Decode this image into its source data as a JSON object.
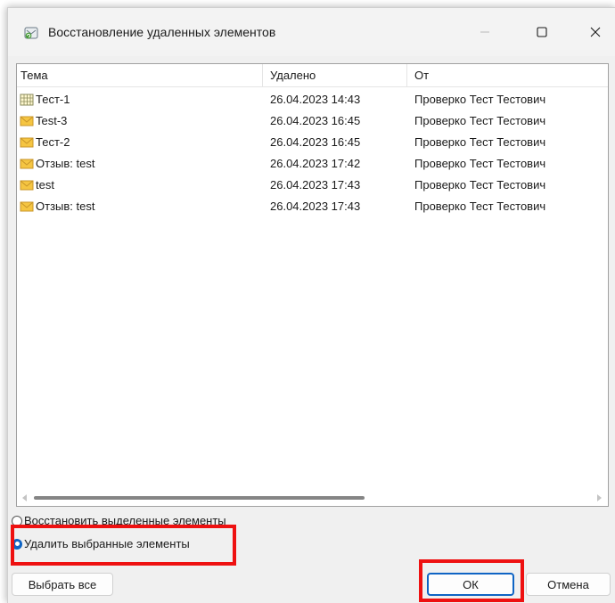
{
  "window": {
    "title": "Восстановление удаленных элементов",
    "icon": "restore-mailbox-icon",
    "controls": [
      "minimize-icon",
      "maximize-icon",
      "close-icon"
    ]
  },
  "list": {
    "columns": [
      "Тема",
      "Удалено",
      "От"
    ],
    "rows": [
      {
        "icon": "calendar-item-icon",
        "subject": "Тест-1",
        "deleted": "26.04.2023 14:43",
        "from": "Проверко Тест Тестович"
      },
      {
        "icon": "envelope-icon",
        "subject": "Test-3",
        "deleted": "26.04.2023 16:45",
        "from": "Проверко Тест Тестович"
      },
      {
        "icon": "envelope-icon",
        "subject": "Тест-2",
        "deleted": "26.04.2023 16:45",
        "from": "Проверко Тест Тестович"
      },
      {
        "icon": "envelope-icon",
        "subject": "Отзыв: test",
        "deleted": "26.04.2023 17:42",
        "from": "Проверко Тест Тестович"
      },
      {
        "icon": "envelope-icon",
        "subject": "test",
        "deleted": "26.04.2023 17:43",
        "from": "Проверко Тест Тестович"
      },
      {
        "icon": "envelope-icon",
        "subject": "Отзыв: test",
        "deleted": "26.04.2023 17:43",
        "from": "Проверко Тест Тестович"
      }
    ]
  },
  "options": {
    "restore_label": "Восстановить выделенные элементы",
    "restore_selected": false,
    "delete_label": "Удалить выбранные элементы",
    "delete_selected": true
  },
  "buttons": {
    "select_all": "Выбрать все",
    "ok": "ОК",
    "cancel": "Отмена"
  },
  "colors": {
    "accent": "#0f64c4",
    "highlight": "#ee1111",
    "envelope": "#f5c542"
  }
}
